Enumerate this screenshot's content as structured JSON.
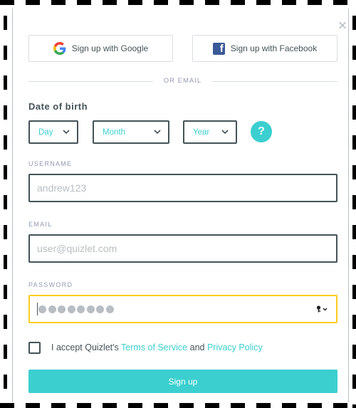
{
  "dialog": {
    "close_symbol": "×"
  },
  "social": {
    "google_label": "Sign up with Google",
    "facebook_label": "Sign up with Facebook",
    "facebook_glyph": "f"
  },
  "divider": {
    "text": "OR EMAIL"
  },
  "dob": {
    "label": "Date of birth",
    "day": "Day",
    "month": "Month",
    "year": "Year",
    "help_glyph": "?"
  },
  "username": {
    "label": "USERNAME",
    "placeholder": "andrew123"
  },
  "email": {
    "label": "EMAIL",
    "placeholder": "user@quizlet.com"
  },
  "password": {
    "label": "PASSWORD",
    "masked_length": 8,
    "border_color": "#ffcd1f"
  },
  "terms": {
    "prefix": "I accept Quizlet's ",
    "tos_link": "Terms of Service",
    "middle": " and ",
    "privacy_link": "Privacy Policy"
  },
  "submit": {
    "label": "Sign up"
  },
  "colors": {
    "accent": "#3ccfcf",
    "text": "#455358",
    "muted": "#939bb4",
    "google_blue": "#4285f4",
    "facebook_blue": "#3b5998"
  },
  "icons": [
    "close-icon",
    "google-icon",
    "facebook-icon",
    "chevron-down-icon",
    "help-icon",
    "key-icon"
  ]
}
